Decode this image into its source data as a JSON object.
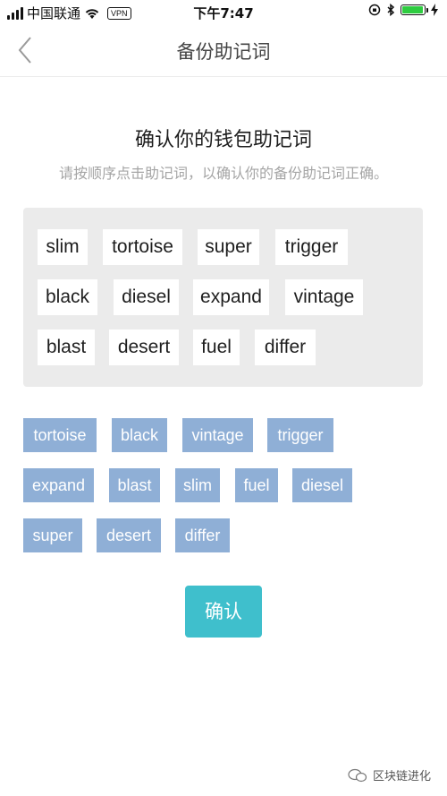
{
  "status_bar": {
    "carrier": "中国联通",
    "vpn": "VPN",
    "time": "下午7:47",
    "battery_level": 0.95
  },
  "nav": {
    "title": "备份助记词"
  },
  "main": {
    "title": "确认你的钱包助记词",
    "instruction": "请按顺序点击助记词，以确认你的备份助记词正确。"
  },
  "selected_words": [
    {
      "word": "slim"
    },
    {
      "word": "tortoise"
    },
    {
      "word": "super"
    },
    {
      "word": "trigger"
    },
    {
      "word": "black"
    },
    {
      "word": "diesel"
    },
    {
      "word": "expand"
    },
    {
      "word": "vintage"
    },
    {
      "word": "blast"
    },
    {
      "word": "desert"
    },
    {
      "word": "fuel"
    },
    {
      "word": "differ"
    }
  ],
  "word_options": [
    {
      "word": "tortoise"
    },
    {
      "word": "black"
    },
    {
      "word": "vintage"
    },
    {
      "word": "trigger"
    },
    {
      "word": "expand"
    },
    {
      "word": "blast"
    },
    {
      "word": "slim"
    },
    {
      "word": "fuel"
    },
    {
      "word": "diesel"
    },
    {
      "word": "super"
    },
    {
      "word": "desert"
    },
    {
      "word": "differ"
    }
  ],
  "confirm_label": "确认",
  "watermark": "区块链进化",
  "colors": {
    "option_bg": "#8fafd6",
    "confirm_bg": "#3fbfcc",
    "panel_bg": "#ebebeb"
  }
}
